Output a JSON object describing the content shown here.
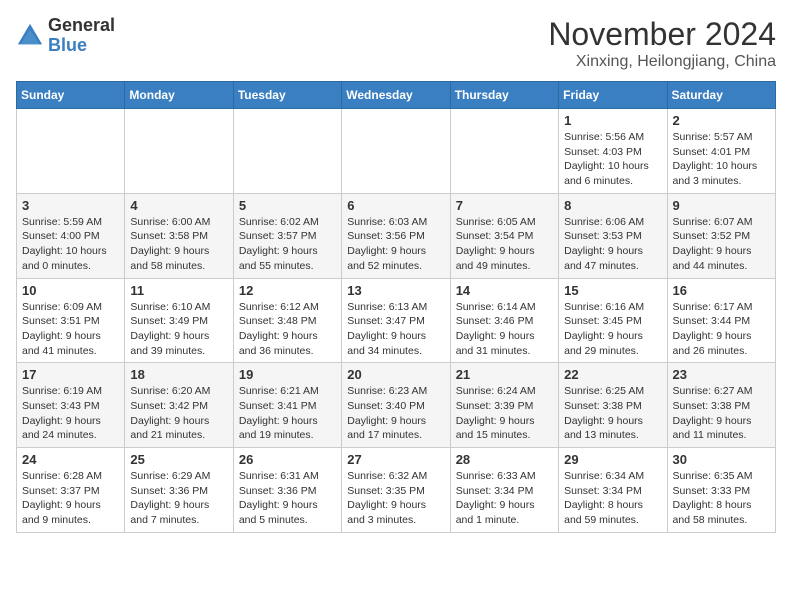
{
  "logo": {
    "general": "General",
    "blue": "Blue"
  },
  "title": "November 2024",
  "subtitle": "Xinxing, Heilongjiang, China",
  "header_days": [
    "Sunday",
    "Monday",
    "Tuesday",
    "Wednesday",
    "Thursday",
    "Friday",
    "Saturday"
  ],
  "weeks": [
    [
      {
        "day": "",
        "info": ""
      },
      {
        "day": "",
        "info": ""
      },
      {
        "day": "",
        "info": ""
      },
      {
        "day": "",
        "info": ""
      },
      {
        "day": "",
        "info": ""
      },
      {
        "day": "1",
        "info": "Sunrise: 5:56 AM\nSunset: 4:03 PM\nDaylight: 10 hours and 6 minutes."
      },
      {
        "day": "2",
        "info": "Sunrise: 5:57 AM\nSunset: 4:01 PM\nDaylight: 10 hours and 3 minutes."
      }
    ],
    [
      {
        "day": "3",
        "info": "Sunrise: 5:59 AM\nSunset: 4:00 PM\nDaylight: 10 hours and 0 minutes."
      },
      {
        "day": "4",
        "info": "Sunrise: 6:00 AM\nSunset: 3:58 PM\nDaylight: 9 hours and 58 minutes."
      },
      {
        "day": "5",
        "info": "Sunrise: 6:02 AM\nSunset: 3:57 PM\nDaylight: 9 hours and 55 minutes."
      },
      {
        "day": "6",
        "info": "Sunrise: 6:03 AM\nSunset: 3:56 PM\nDaylight: 9 hours and 52 minutes."
      },
      {
        "day": "7",
        "info": "Sunrise: 6:05 AM\nSunset: 3:54 PM\nDaylight: 9 hours and 49 minutes."
      },
      {
        "day": "8",
        "info": "Sunrise: 6:06 AM\nSunset: 3:53 PM\nDaylight: 9 hours and 47 minutes."
      },
      {
        "day": "9",
        "info": "Sunrise: 6:07 AM\nSunset: 3:52 PM\nDaylight: 9 hours and 44 minutes."
      }
    ],
    [
      {
        "day": "10",
        "info": "Sunrise: 6:09 AM\nSunset: 3:51 PM\nDaylight: 9 hours and 41 minutes."
      },
      {
        "day": "11",
        "info": "Sunrise: 6:10 AM\nSunset: 3:49 PM\nDaylight: 9 hours and 39 minutes."
      },
      {
        "day": "12",
        "info": "Sunrise: 6:12 AM\nSunset: 3:48 PM\nDaylight: 9 hours and 36 minutes."
      },
      {
        "day": "13",
        "info": "Sunrise: 6:13 AM\nSunset: 3:47 PM\nDaylight: 9 hours and 34 minutes."
      },
      {
        "day": "14",
        "info": "Sunrise: 6:14 AM\nSunset: 3:46 PM\nDaylight: 9 hours and 31 minutes."
      },
      {
        "day": "15",
        "info": "Sunrise: 6:16 AM\nSunset: 3:45 PM\nDaylight: 9 hours and 29 minutes."
      },
      {
        "day": "16",
        "info": "Sunrise: 6:17 AM\nSunset: 3:44 PM\nDaylight: 9 hours and 26 minutes."
      }
    ],
    [
      {
        "day": "17",
        "info": "Sunrise: 6:19 AM\nSunset: 3:43 PM\nDaylight: 9 hours and 24 minutes."
      },
      {
        "day": "18",
        "info": "Sunrise: 6:20 AM\nSunset: 3:42 PM\nDaylight: 9 hours and 21 minutes."
      },
      {
        "day": "19",
        "info": "Sunrise: 6:21 AM\nSunset: 3:41 PM\nDaylight: 9 hours and 19 minutes."
      },
      {
        "day": "20",
        "info": "Sunrise: 6:23 AM\nSunset: 3:40 PM\nDaylight: 9 hours and 17 minutes."
      },
      {
        "day": "21",
        "info": "Sunrise: 6:24 AM\nSunset: 3:39 PM\nDaylight: 9 hours and 15 minutes."
      },
      {
        "day": "22",
        "info": "Sunrise: 6:25 AM\nSunset: 3:38 PM\nDaylight: 9 hours and 13 minutes."
      },
      {
        "day": "23",
        "info": "Sunrise: 6:27 AM\nSunset: 3:38 PM\nDaylight: 9 hours and 11 minutes."
      }
    ],
    [
      {
        "day": "24",
        "info": "Sunrise: 6:28 AM\nSunset: 3:37 PM\nDaylight: 9 hours and 9 minutes."
      },
      {
        "day": "25",
        "info": "Sunrise: 6:29 AM\nSunset: 3:36 PM\nDaylight: 9 hours and 7 minutes."
      },
      {
        "day": "26",
        "info": "Sunrise: 6:31 AM\nSunset: 3:36 PM\nDaylight: 9 hours and 5 minutes."
      },
      {
        "day": "27",
        "info": "Sunrise: 6:32 AM\nSunset: 3:35 PM\nDaylight: 9 hours and 3 minutes."
      },
      {
        "day": "28",
        "info": "Sunrise: 6:33 AM\nSunset: 3:34 PM\nDaylight: 9 hours and 1 minute."
      },
      {
        "day": "29",
        "info": "Sunrise: 6:34 AM\nSunset: 3:34 PM\nDaylight: 8 hours and 59 minutes."
      },
      {
        "day": "30",
        "info": "Sunrise: 6:35 AM\nSunset: 3:33 PM\nDaylight: 8 hours and 58 minutes."
      }
    ]
  ]
}
